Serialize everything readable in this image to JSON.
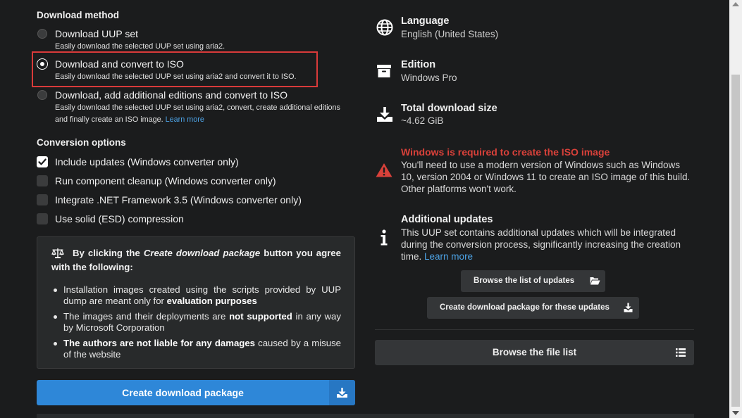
{
  "download_method": {
    "title": "Download method",
    "options": [
      {
        "label": "Download UUP set",
        "desc": "Easily download the selected UUP set using aria2.",
        "checked": false
      },
      {
        "label": "Download and convert to ISO",
        "desc": "Easily download the selected UUP set using aria2 and convert it to ISO.",
        "checked": true
      },
      {
        "label": "Download, add additional editions and convert to ISO",
        "desc_line1": "Easily download the selected UUP set using aria2, convert, create additional editions",
        "desc_line2": "and finally create an ISO image.",
        "link": "Learn more",
        "checked": false
      }
    ]
  },
  "conversion": {
    "title": "Conversion options",
    "items": [
      {
        "label": "Include updates (Windows converter only)",
        "checked": true
      },
      {
        "label": "Run component cleanup (Windows converter only)",
        "checked": false
      },
      {
        "label": "Integrate .NET Framework 3.5 (Windows converter only)",
        "checked": false
      },
      {
        "label": "Use solid (ESD) compression",
        "checked": false
      }
    ]
  },
  "agreement": {
    "head_pre": "By clicking the ",
    "head_em": "Create download package",
    "head_post": " button you agree with the following:",
    "b1_pre": "Installation images created using the scripts provided by UUP dump are meant only for ",
    "b1_bold": "evaluation purposes",
    "b2_pre": "The images and their deployments are ",
    "b2_bold": "not supported",
    "b2_post": " in any way by Microsoft Corporation",
    "b3_bold": "The authors are not liable for any damages",
    "b3_post": " caused by a misuse of the website"
  },
  "create_button": {
    "label": "Create download package"
  },
  "info": {
    "language": {
      "title": "Language",
      "value": "English (United States)"
    },
    "edition": {
      "title": "Edition",
      "value": "Windows Pro"
    },
    "size": {
      "title": "Total download size",
      "value": "~4.62 GiB"
    },
    "warning": {
      "title": "Windows is required to create the ISO image",
      "line1": "You'll need to use a modern version of Windows such as Windows",
      "line2": "10, version 2004 or Windows 11 to create an ISO image of this build.",
      "line3": "Other platforms won't work."
    },
    "updates": {
      "title": "Additional updates",
      "line1": "This UUP set contains additional updates which will be integrated",
      "line2": "during the conversion process, significantly increasing the creation",
      "line3": "time.",
      "link": "Learn more"
    }
  },
  "buttons": {
    "browse_updates": "Browse the list of updates",
    "create_updates_pkg": "Create download package for these updates",
    "browse_files": "Browse the file list"
  },
  "colors": {
    "background": "#1b1c1d",
    "accent_blue": "#2e87d8",
    "warning_red": "#d9413a",
    "highlight_border": "#d93a3a",
    "link": "#4da3e6"
  },
  "icons": {
    "language": "globe-icon",
    "edition": "archive-box-icon",
    "size": "download-icon",
    "warning": "warning-triangle-icon",
    "updates": "info-icon",
    "agreement": "balance-scale-icon",
    "browse_updates": "folder-open-icon",
    "create_updates": "download-icon",
    "file_list": "list-icon"
  }
}
